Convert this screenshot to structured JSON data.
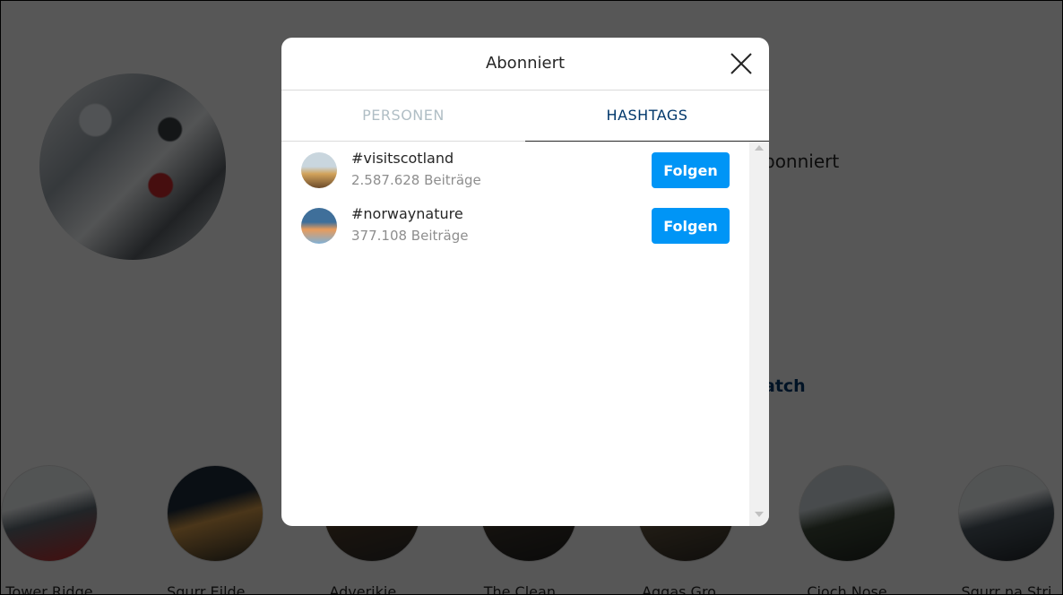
{
  "background": {
    "following_text": "bonniert",
    "link_text": "atch",
    "highlights": [
      {
        "label": "Tower Ridge",
        "colors": [
          "#eceff1",
          "#5f6a72",
          "#c62828"
        ]
      },
      {
        "label": "Sgurr Eilde ...",
        "colors": [
          "#1d2b3a",
          "#d49a4a",
          "#2a2a24"
        ]
      },
      {
        "label": "Adverikie ...",
        "colors": [
          "#8c6239",
          "#4a3a28",
          "#2b2b2b"
        ]
      },
      {
        "label": "The Clean ...",
        "colors": [
          "#6b5a44",
          "#3a332a",
          "#1f1f1f"
        ]
      },
      {
        "label": "Aggas Gro...",
        "colors": [
          "#9a8566",
          "#5a4d3a",
          "#2e2a24"
        ]
      },
      {
        "label": "Cioch Nose",
        "colors": [
          "#cfd8dc",
          "#3e4a3a",
          "#1f241e"
        ]
      },
      {
        "label": "Sgurr na Stri",
        "colors": [
          "#eceff1",
          "#4e5a63",
          "#1f2428"
        ]
      }
    ]
  },
  "modal": {
    "title": "Abonniert",
    "tabs": [
      {
        "label": "PERSONEN",
        "active": false
      },
      {
        "label": "HASHTAGS",
        "active": true
      }
    ],
    "items": [
      {
        "name": "#visitscotland",
        "count": "2.587.628 Beiträge",
        "button": "Folgen",
        "avatar_colors": [
          "#c9d6de",
          "#d2a35a",
          "#6b4a2a"
        ]
      },
      {
        "name": "#norwaynature",
        "count": "377.108 Beiträge",
        "button": "Folgen",
        "avatar_colors": [
          "#3f6f9a",
          "#e89b5b",
          "#7fb0d6"
        ]
      }
    ]
  },
  "colors": {
    "accent": "#0095f6",
    "active_tab": "#00376b",
    "inactive_tab": "#b0bec5",
    "secondary_text": "#8e8e8e"
  }
}
